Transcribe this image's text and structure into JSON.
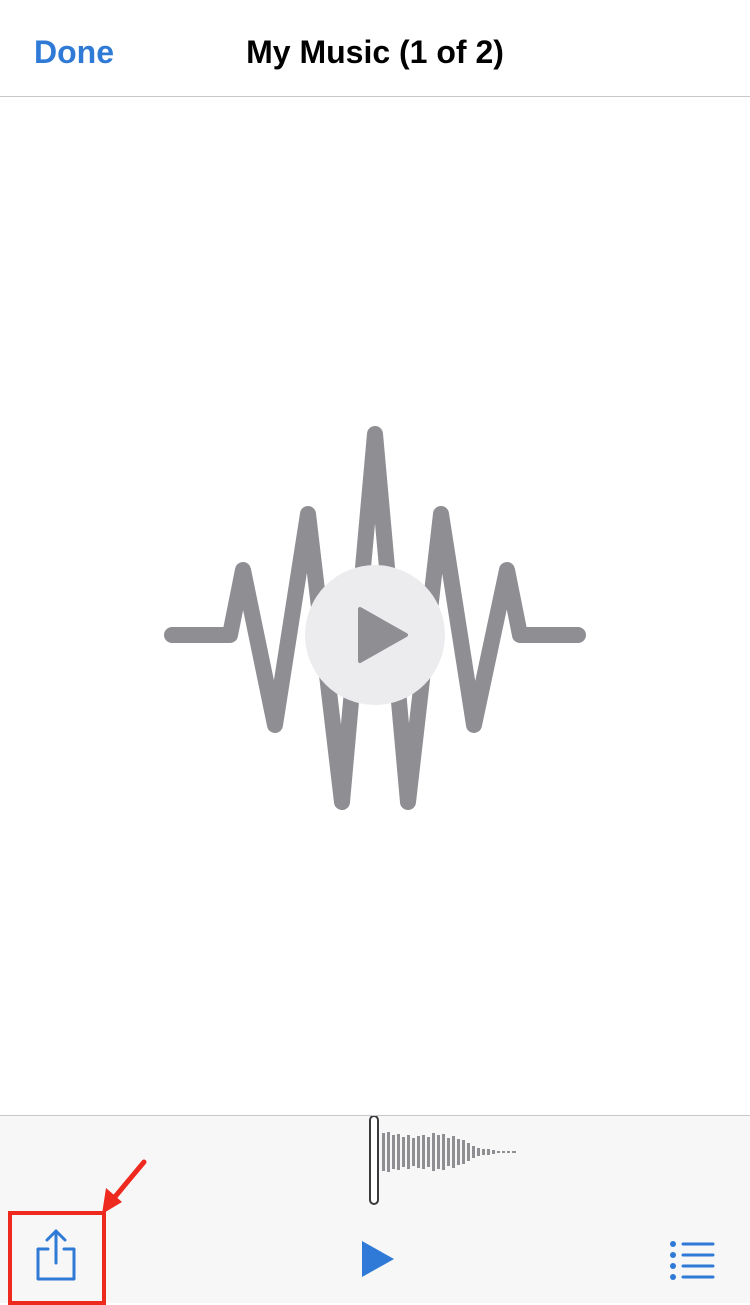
{
  "header": {
    "done_label": "Done",
    "title": "My Music (1 of 2)"
  },
  "icons": {
    "preview": "audio-waveform-icon",
    "play_overlay": "play-icon",
    "share": "share-icon",
    "toolbar_play": "play-icon",
    "list": "list-icon",
    "annotation": "red-arrow-annotation"
  },
  "colors": {
    "accent": "#2f7ad6",
    "waveform": "#8e8e93",
    "overlay_bg": "#ececee",
    "annotation": "#ee2a1f",
    "toolbar_bg": "#f7f7f7"
  }
}
